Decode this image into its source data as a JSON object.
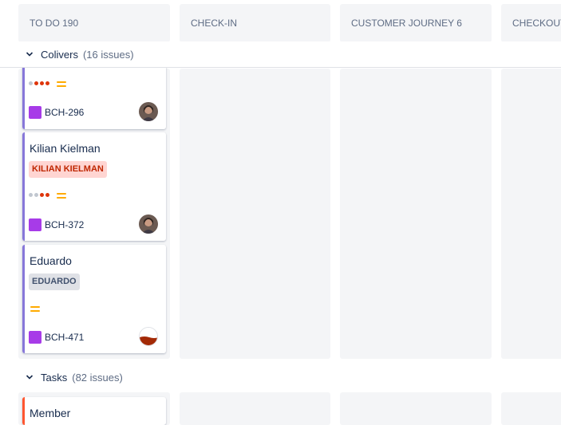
{
  "columns": [
    {
      "title": "TO DO 190"
    },
    {
      "title": "CHECK-IN"
    },
    {
      "title": "CUSTOMER JOURNEY 6"
    },
    {
      "title": "CHECKOUT"
    }
  ],
  "swimlanes": [
    {
      "name": "Colivers",
      "count": "(16 issues)"
    },
    {
      "name": "Tasks",
      "count": "(82 issues)"
    }
  ],
  "cards": [
    {
      "key": "BCH-296",
      "priority": "medium",
      "type_icon": "epic-icon",
      "avatar": "avatar-photo"
    },
    {
      "title": "Kilian Kielman",
      "label": "KILIAN KIELMAN",
      "key": "BCH-372",
      "priority": "medium",
      "type_icon": "epic-icon",
      "avatar": "avatar-photo"
    },
    {
      "title": "Eduardo",
      "label": "EDUARDO",
      "key": "BCH-471",
      "priority": "medium",
      "type_icon": "epic-icon",
      "avatar": "avatar-half-red"
    },
    {
      "title": "Member"
    }
  ],
  "colors": {
    "accent_purple": "#8777d9",
    "accent_red": "#ff5630",
    "epic_purple": "#a73be8",
    "priority_medium": "#ffab00",
    "label_red_bg": "#ffd5d2",
    "label_red_text": "#bf2600",
    "label_gray_bg": "#dfe1e6",
    "label_gray_text": "#42526e"
  }
}
